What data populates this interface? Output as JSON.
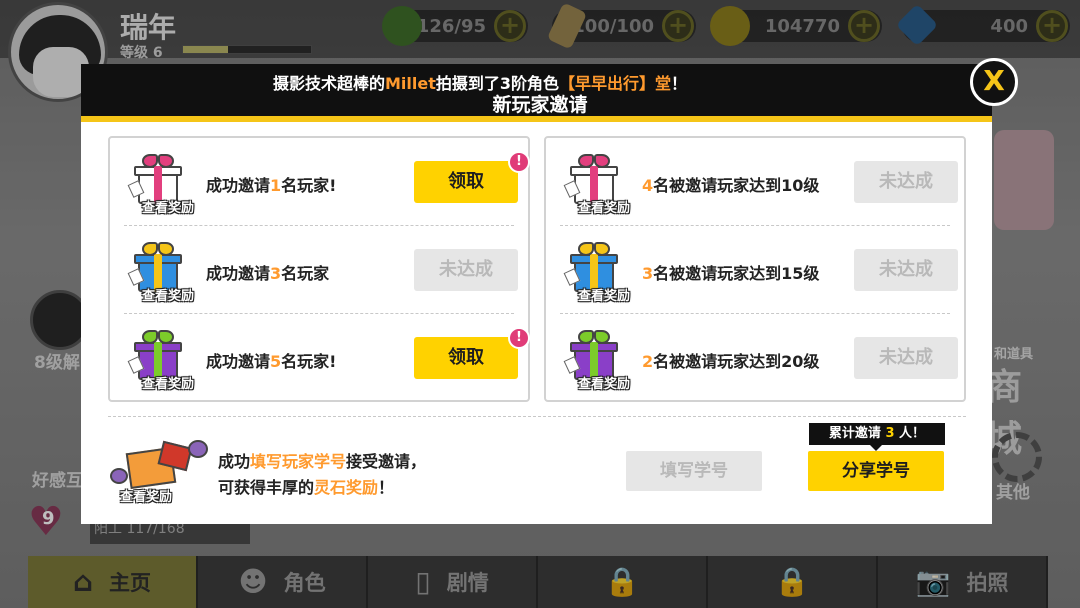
{
  "player": {
    "name": "瑞年",
    "level_label": "等级",
    "level": "6",
    "exp_fraction": 0.35
  },
  "resources": [
    {
      "icon": "leaf-icon",
      "value": "126/95",
      "color": "#3f8a2a"
    },
    {
      "icon": "stamina-can-icon",
      "value": "100/100",
      "color": "#c8a44a"
    },
    {
      "icon": "coin-icon",
      "value": "104770",
      "color": "#b8a21e"
    },
    {
      "icon": "gem-icon",
      "value": "400",
      "color": "#2a74b8"
    }
  ],
  "plus_label": "+",
  "background_side": {
    "left_labels": [
      "8级解",
      "好感互"
    ],
    "heart_number": "9",
    "mini_bar_text": "阳工   117/168",
    "shop_small": "和道具",
    "shop_big": "商城",
    "other_label": "其他"
  },
  "modal": {
    "announce": {
      "prefix": "摄影技术超棒的",
      "player": "Millet",
      "middle": "拍摄到了3阶角色",
      "role": "【早早出行】堂",
      "suffix": "！"
    },
    "title": "新玩家邀请",
    "close_label": "X",
    "left_rows": [
      {
        "pre": "成功邀请",
        "num": "1",
        "post": "名玩家!",
        "button": "领取",
        "state": "claim",
        "badge": "!",
        "gift_color": "#ffffff",
        "ribbon": "#e23f7e",
        "gift_label": "查看奖励"
      },
      {
        "pre": "成功邀请",
        "num": "3",
        "post": "名玩家",
        "button": "未达成",
        "state": "disabled",
        "badge": "",
        "gift_color": "#2f8fe0",
        "ribbon": "#f5c518",
        "gift_label": "查看奖励"
      },
      {
        "pre": "成功邀请",
        "num": "5",
        "post": "名玩家!",
        "button": "领取",
        "state": "claim",
        "badge": "!",
        "gift_color": "#8a3fc8",
        "ribbon": "#7ccc2a",
        "gift_label": "查看奖励"
      }
    ],
    "right_rows": [
      {
        "pre": "",
        "num": "4",
        "post": "名被邀请玩家达到10级",
        "button": "未达成",
        "state": "disabled",
        "badge": "",
        "gift_color": "#ffffff",
        "ribbon": "#e23f7e",
        "gift_label": "查看奖励"
      },
      {
        "pre": "",
        "num": "3",
        "post": "名被邀请玩家达到15级",
        "button": "未达成",
        "state": "disabled",
        "badge": "",
        "gift_color": "#2f8fe0",
        "ribbon": "#f5c518",
        "gift_label": "查看奖励"
      },
      {
        "pre": "",
        "num": "2",
        "post": "名被邀请玩家达到20级",
        "button": "未达成",
        "state": "disabled",
        "badge": "",
        "gift_color": "#8a3fc8",
        "ribbon": "#7ccc2a",
        "gift_label": "查看奖励"
      }
    ],
    "bottom": {
      "gift_label": "查看奖励",
      "line1_pre": "成功",
      "line1_hl": "填写玩家学号",
      "line1_post": "接受邀请，",
      "line2_pre": "可获得丰厚的",
      "line2_hl": "灵石奖励",
      "line2_post": "！",
      "fill_button": "填写学号",
      "share_button": "分享学号",
      "tip_pre": "累计邀请",
      "tip_count": "3",
      "tip_post": "人！"
    }
  },
  "nav": [
    {
      "icon": "home-icon",
      "glyph": "⌂",
      "label": "主页",
      "active": true
    },
    {
      "icon": "characters-icon",
      "glyph": "☻",
      "label": "角色",
      "active": false
    },
    {
      "icon": "story-cards-icon",
      "glyph": "▯",
      "label": "剧情",
      "active": false
    },
    {
      "icon": "lock-icon",
      "glyph": "🔒",
      "label": "",
      "active": false
    },
    {
      "icon": "lock-icon",
      "glyph": "🔒",
      "label": "",
      "active": false
    },
    {
      "icon": "camera-icon",
      "glyph": "📷",
      "label": "拍照",
      "active": false
    }
  ],
  "colors": {
    "accent_yellow": "#ffd200",
    "highlight_orange": "#ff9a2e",
    "badge_pink": "#e03c78"
  }
}
